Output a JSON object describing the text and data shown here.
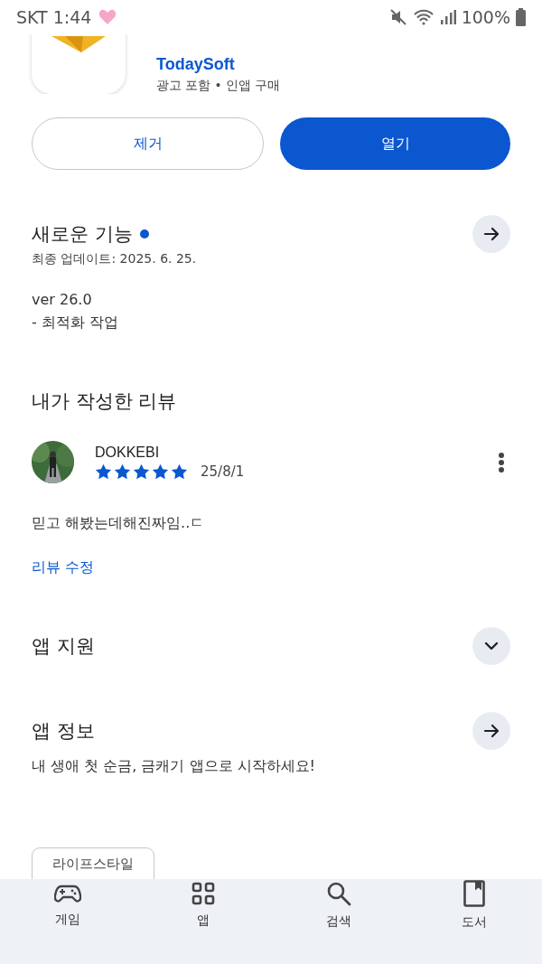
{
  "status_bar": {
    "carrier_time": "SKT 1:44",
    "battery": "100%"
  },
  "app": {
    "developer": "TodaySoft",
    "notes": "광고 포함 • 인앱 구매"
  },
  "buttons": [
    {
      "label": "제거",
      "kind": "outline"
    },
    {
      "label": "열기",
      "kind": "filled"
    }
  ],
  "whats_new": {
    "title": "새로운 기능",
    "new_dot": true,
    "updated": "최종 업데이트: 2025. 6. 25.",
    "lines": [
      "ver 26.0",
      "- 최적화 작업"
    ]
  },
  "my_review": {
    "title": "내가 작성한 리뷰",
    "author": "DOKKEBI",
    "stars": 5,
    "date": "25/8/1",
    "text": "믿고 해봤는데해진짜임..ㄷ",
    "edit_link": "리뷰 수정"
  },
  "sections": [
    {
      "title": "앱 지원",
      "kind": "expand"
    },
    {
      "title": "앱 정보",
      "kind": "arrow",
      "description": "내 생애 첫 순금, 금캐기 앱으로 시작하세요!"
    }
  ],
  "chips": [
    "라이프스타일"
  ],
  "bottom_nav": [
    {
      "label": "게임",
      "kind": "gamepad"
    },
    {
      "label": "앱",
      "kind": "apps"
    },
    {
      "label": "검색",
      "kind": "search"
    },
    {
      "label": "도서",
      "kind": "book"
    }
  ]
}
